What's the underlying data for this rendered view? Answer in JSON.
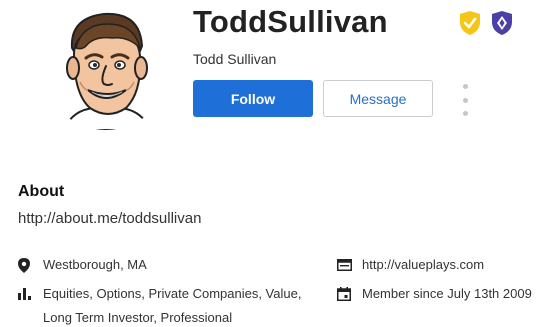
{
  "profile": {
    "username": "ToddSullivan",
    "full_name": "Todd Sullivan",
    "avatar_alt": "caricature avatar",
    "badges": [
      {
        "name": "verified-badge",
        "color": "#f5c518"
      },
      {
        "name": "premium-badge",
        "color": "#4b3fa8"
      }
    ]
  },
  "actions": {
    "follow_label": "Follow",
    "message_label": "Message",
    "follow_color": "#1f6fd8"
  },
  "about": {
    "title": "About",
    "link": "http://about.me/toddsullivan",
    "location": "Westborough, MA",
    "tags": "Equities, Options, Private Companies, Value, Long Term Investor, Professional",
    "website": "http://valueplays.com",
    "member_since": "Member since July 13th 2009"
  },
  "icons": {
    "location": "map-pin-icon",
    "tags": "bar-chart-icon",
    "website": "browser-window-icon",
    "member": "calendar-icon",
    "more": "more-vertical-icon"
  }
}
